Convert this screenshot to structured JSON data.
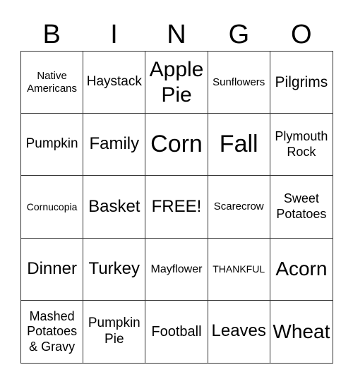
{
  "header": [
    "B",
    "I",
    "N",
    "G",
    "O"
  ],
  "rows": [
    [
      "Native Americans",
      "Haystack",
      "Apple Pie",
      "Sunflowers",
      "Pilgrims"
    ],
    [
      "Pumpkin",
      "Family",
      "Corn",
      "Fall",
      "Plymouth Rock"
    ],
    [
      "Cornucopia",
      "Basket",
      "FREE!",
      "Scarecrow",
      "Sweet Potatoes"
    ],
    [
      "Dinner",
      "Turkey",
      "Mayflower",
      "THANKFUL",
      "Acorn"
    ],
    [
      "Mashed Potatoes & Gravy",
      "Pumpkin Pie",
      "Football",
      "Leaves",
      "Wheat"
    ]
  ]
}
